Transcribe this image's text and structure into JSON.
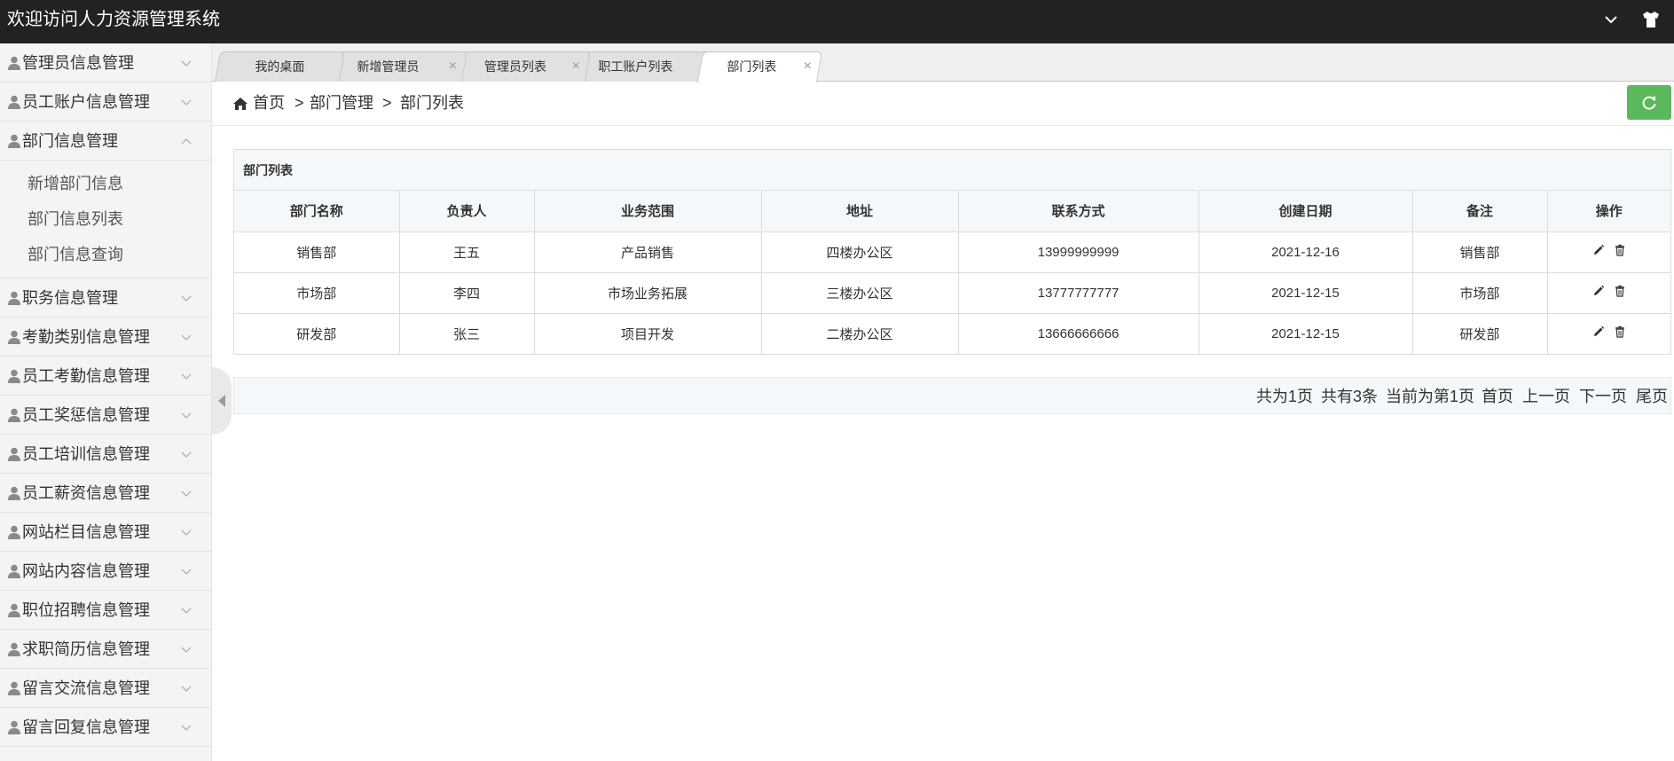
{
  "header": {
    "title": "欢迎访问人力资源管理系统"
  },
  "sidebar": {
    "items": [
      {
        "label": "管理员信息管理",
        "expanded": false
      },
      {
        "label": "员工账户信息管理",
        "expanded": false
      },
      {
        "label": "部门信息管理",
        "expanded": true,
        "children": [
          "新增部门信息",
          "部门信息列表",
          "部门信息查询"
        ]
      },
      {
        "label": "职务信息管理",
        "expanded": false
      },
      {
        "label": "考勤类别信息管理",
        "expanded": false
      },
      {
        "label": "员工考勤信息管理",
        "expanded": false
      },
      {
        "label": "员工奖惩信息管理",
        "expanded": false
      },
      {
        "label": "员工培训信息管理",
        "expanded": false
      },
      {
        "label": "员工薪资信息管理",
        "expanded": false
      },
      {
        "label": "网站栏目信息管理",
        "expanded": false
      },
      {
        "label": "网站内容信息管理",
        "expanded": false
      },
      {
        "label": "职位招聘信息管理",
        "expanded": false
      },
      {
        "label": "求职简历信息管理",
        "expanded": false
      },
      {
        "label": "留言交流信息管理",
        "expanded": false
      },
      {
        "label": "留言回复信息管理",
        "expanded": false
      }
    ]
  },
  "tabs": [
    {
      "label": "我的桌面",
      "closable": false,
      "active": false
    },
    {
      "label": "新增管理员",
      "closable": true,
      "active": false
    },
    {
      "label": "管理员列表",
      "closable": true,
      "active": false
    },
    {
      "label": "职工账户列表",
      "closable": true,
      "active": false
    },
    {
      "label": "部门列表",
      "closable": true,
      "active": true
    }
  ],
  "tab_close_glyph": "×",
  "breadcrumb": {
    "home": "首页",
    "sep": ">",
    "level1": "部门管理",
    "level2": "部门列表"
  },
  "panel": {
    "title": "部门列表"
  },
  "table": {
    "columns": [
      "部门名称",
      "负责人",
      "业务范围",
      "地址",
      "联系方式",
      "创建日期",
      "备注",
      "操作"
    ],
    "rows": [
      [
        "销售部",
        "王五",
        "产品销售",
        "四楼办公区",
        "13999999999",
        "2021-12-16",
        "销售部"
      ],
      [
        "市场部",
        "李四",
        "市场业务拓展",
        "三楼办公区",
        "13777777777",
        "2021-12-15",
        "市场部"
      ],
      [
        "研发部",
        "张三",
        "项目开发",
        "二楼办公区",
        "13666666666",
        "2021-12-15",
        "研发部"
      ]
    ]
  },
  "pager": {
    "total_pages": "共为1页",
    "total_records": "共有3条",
    "current": "当前为第1页",
    "first": "首页",
    "prev": "上一页",
    "next": "下一页",
    "last": "尾页"
  },
  "colors": {
    "topbar": "#222222",
    "refresh": "#5cb85c",
    "table_head": "#f4f8fb"
  },
  "icons": [
    "chevron-down-icon",
    "shirt-icon",
    "person-icon",
    "home-icon",
    "refresh-icon",
    "edit-icon",
    "trash-icon",
    "collapse-arrow-icon"
  ]
}
